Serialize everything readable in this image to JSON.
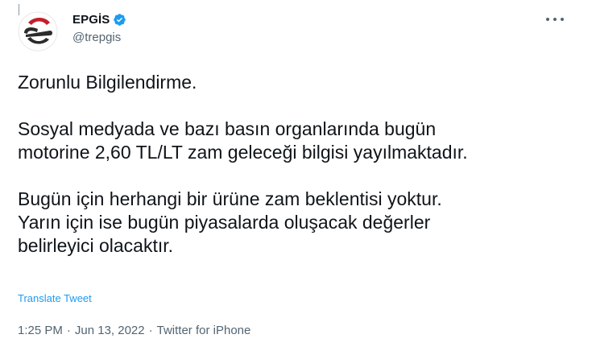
{
  "author": {
    "name": "EPGİS",
    "handle": "@trepgis",
    "verified": true,
    "avatar_icon": "epgis-logo-icon",
    "accent_color": "#c41e2a"
  },
  "menu": {
    "icon": "more-options-icon"
  },
  "tweet": {
    "paragraphs": [
      "Zorunlu Bilgilendirme.",
      "Sosyal medyada ve bazı basın organlarında bugün\nmotorine 2,60 TL/LT zam geleceği bilgisi yayılmaktadır.",
      "Bugün için herhangi bir ürüne zam beklentisi yoktur.\nYarın için ise bugün piyasalarda oluşacak değerler\nbelirleyici olacaktır."
    ],
    "translate_label": "Translate Tweet"
  },
  "meta": {
    "time": "1:25 PM",
    "separator": "·",
    "date": "Jun 13, 2022",
    "source": "Twitter for iPhone"
  },
  "colors": {
    "text": "#0f1419",
    "secondary": "#536471",
    "link": "#1d9bf0",
    "verified": "#1d9bf0"
  }
}
